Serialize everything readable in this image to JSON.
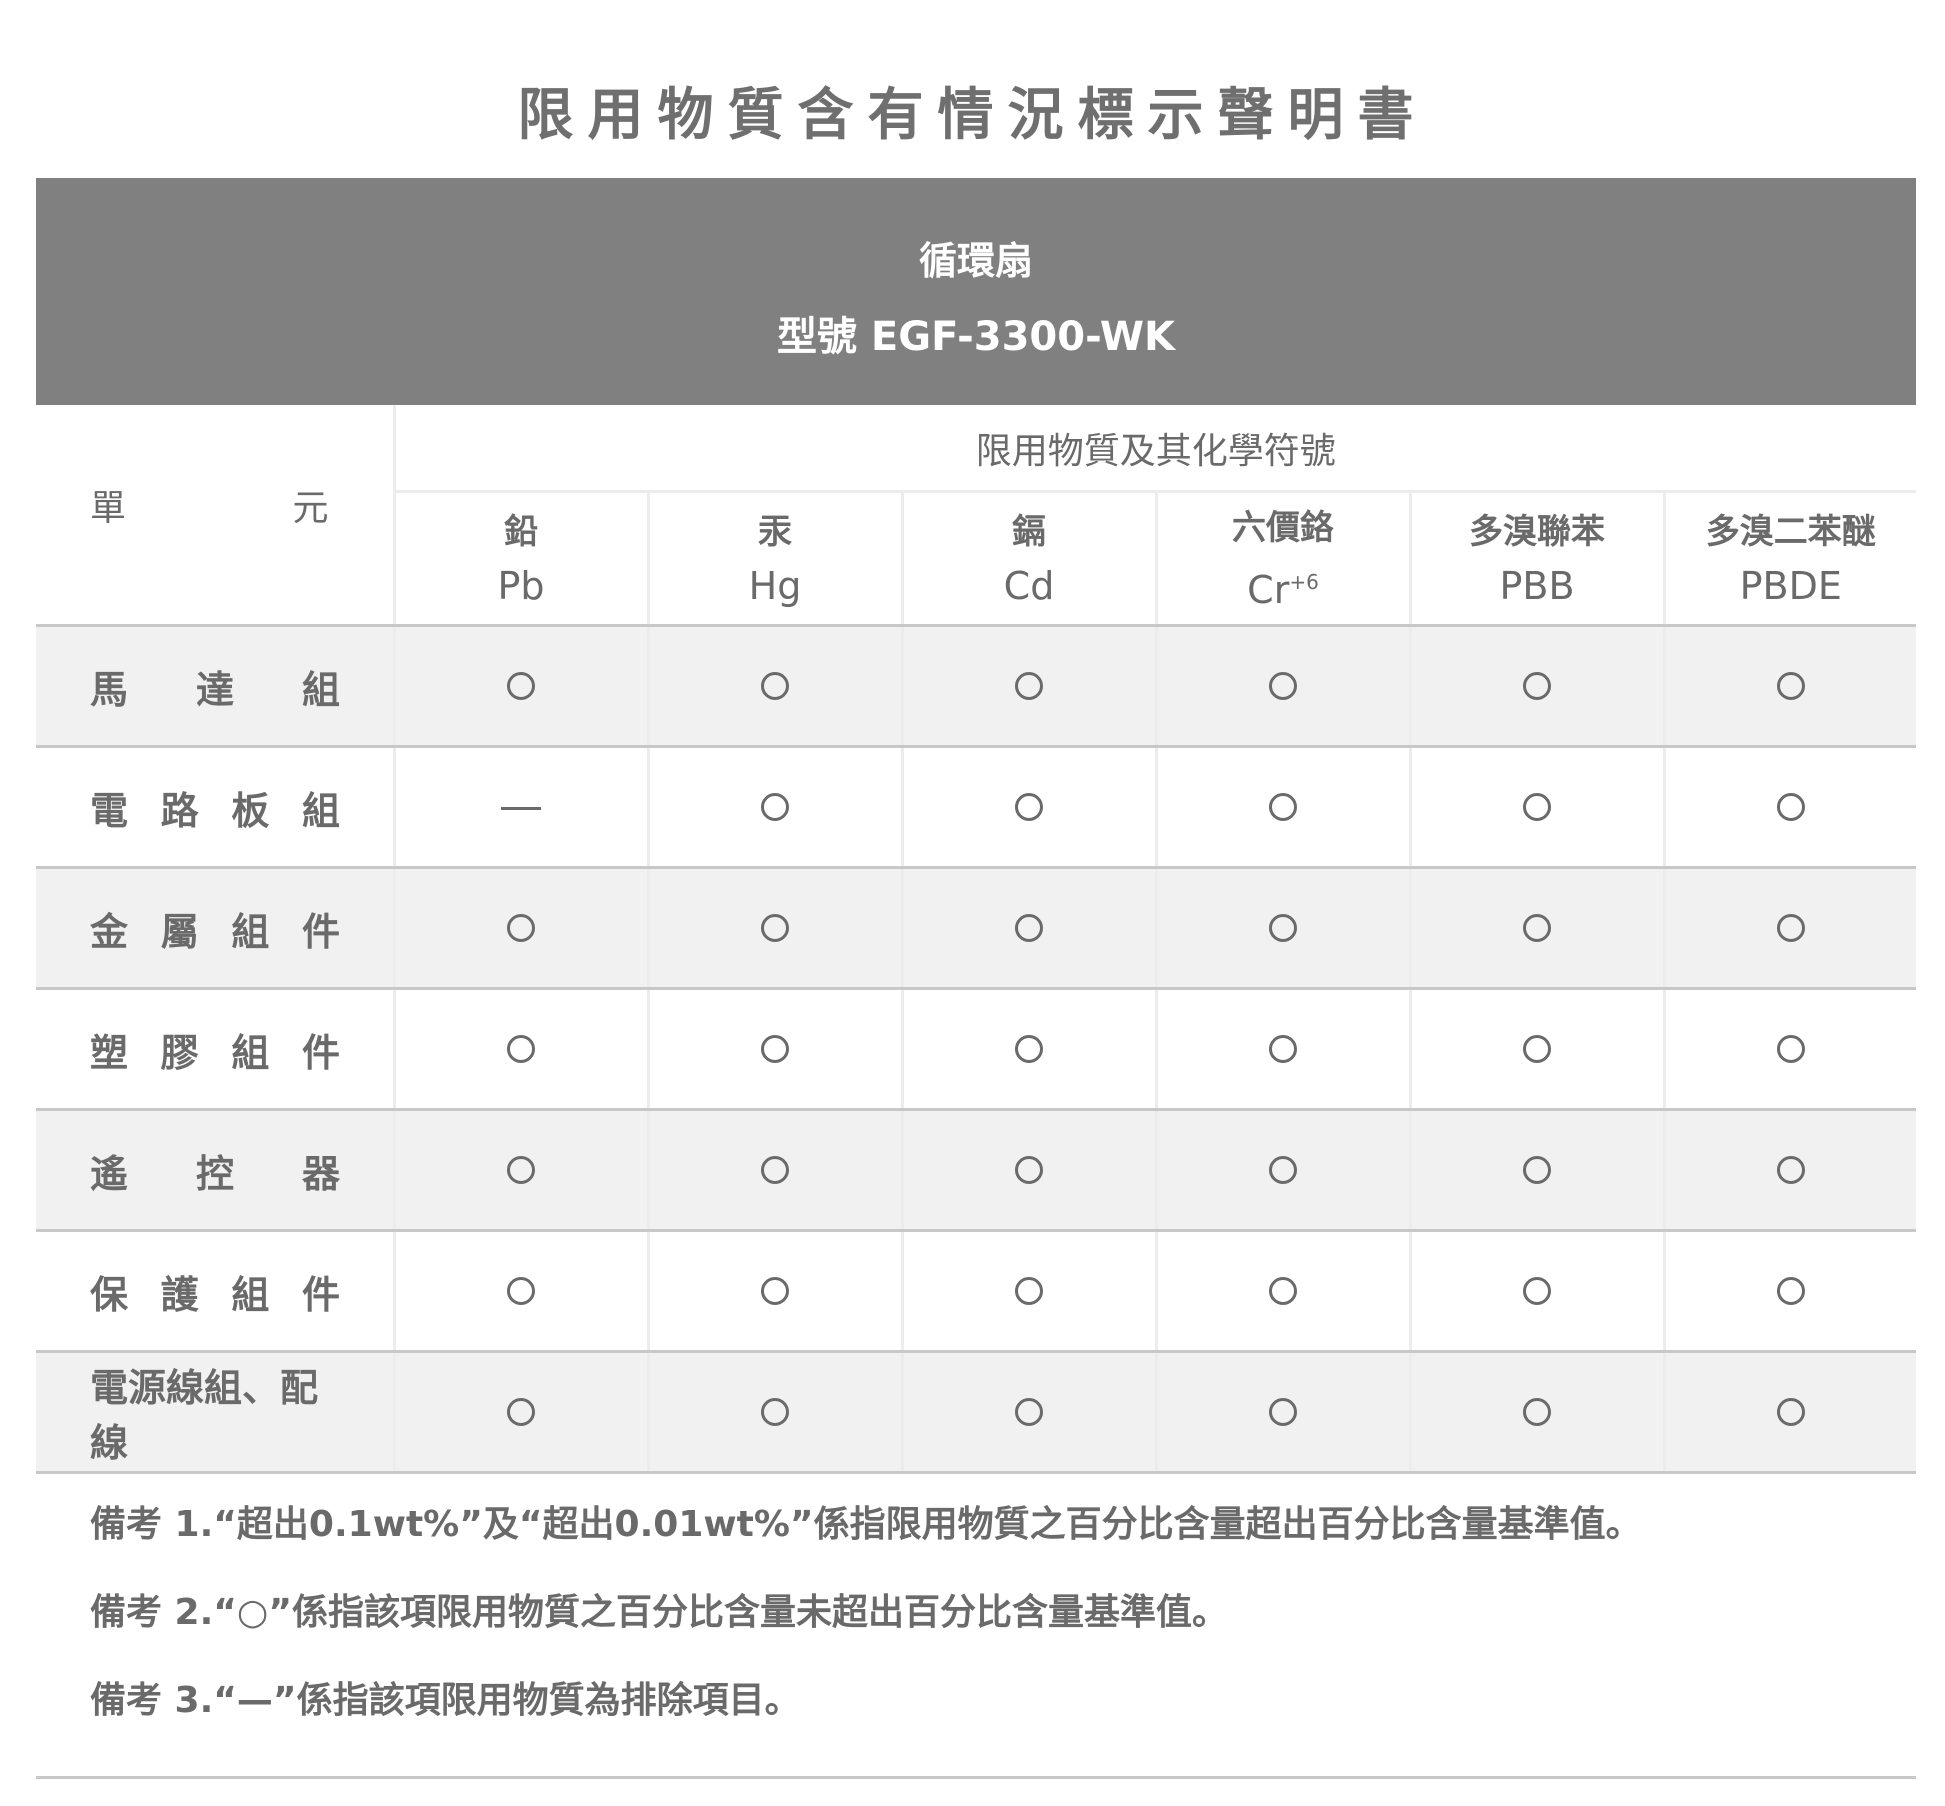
{
  "title": "限用物質含有情況標示聲明書",
  "product": {
    "name": "循環扇",
    "model_label": "型號",
    "model": "EGF-3300-WK"
  },
  "table": {
    "unit_header": [
      "單",
      "元"
    ],
    "group_header": "限用物質及其化學符號",
    "substances": [
      {
        "name": "鉛",
        "symbol": "Pb",
        "sup": ""
      },
      {
        "name": "汞",
        "symbol": "Hg",
        "sup": ""
      },
      {
        "name": "鎘",
        "symbol": "Cd",
        "sup": ""
      },
      {
        "name": "六價鉻",
        "symbol": "Cr",
        "sup": "+6"
      },
      {
        "name": "多溴聯苯",
        "symbol": "PBB",
        "sup": ""
      },
      {
        "name": "多溴二苯醚",
        "symbol": "PBDE",
        "sup": ""
      }
    ],
    "rows": [
      {
        "unit": [
          "馬",
          "達",
          "組"
        ],
        "marks": [
          "○",
          "○",
          "○",
          "○",
          "○",
          "○"
        ]
      },
      {
        "unit": [
          "電",
          "路",
          "板",
          "組"
        ],
        "marks": [
          "—",
          "○",
          "○",
          "○",
          "○",
          "○"
        ]
      },
      {
        "unit": [
          "金",
          "屬",
          "組",
          "件"
        ],
        "marks": [
          "○",
          "○",
          "○",
          "○",
          "○",
          "○"
        ]
      },
      {
        "unit": [
          "塑",
          "膠",
          "組",
          "件"
        ],
        "marks": [
          "○",
          "○",
          "○",
          "○",
          "○",
          "○"
        ]
      },
      {
        "unit": [
          "遙",
          "控",
          "器"
        ],
        "marks": [
          "○",
          "○",
          "○",
          "○",
          "○",
          "○"
        ]
      },
      {
        "unit": [
          "保",
          "護",
          "組",
          "件"
        ],
        "marks": [
          "○",
          "○",
          "○",
          "○",
          "○",
          "○"
        ]
      },
      {
        "unit": [
          "電源線組、配線"
        ],
        "marks": [
          "○",
          "○",
          "○",
          "○",
          "○",
          "○"
        ]
      }
    ]
  },
  "notes": [
    "備考 1.“超出0.1wt%”及“超出0.01wt%”係指限用物質之百分比含量超出百分比含量基準值。",
    "備考 2.“○”係指該項限用物質之百分比含量未超出百分比含量基準值。",
    "備考 3.“—”係指該項限用物質為排除項目。"
  ]
}
